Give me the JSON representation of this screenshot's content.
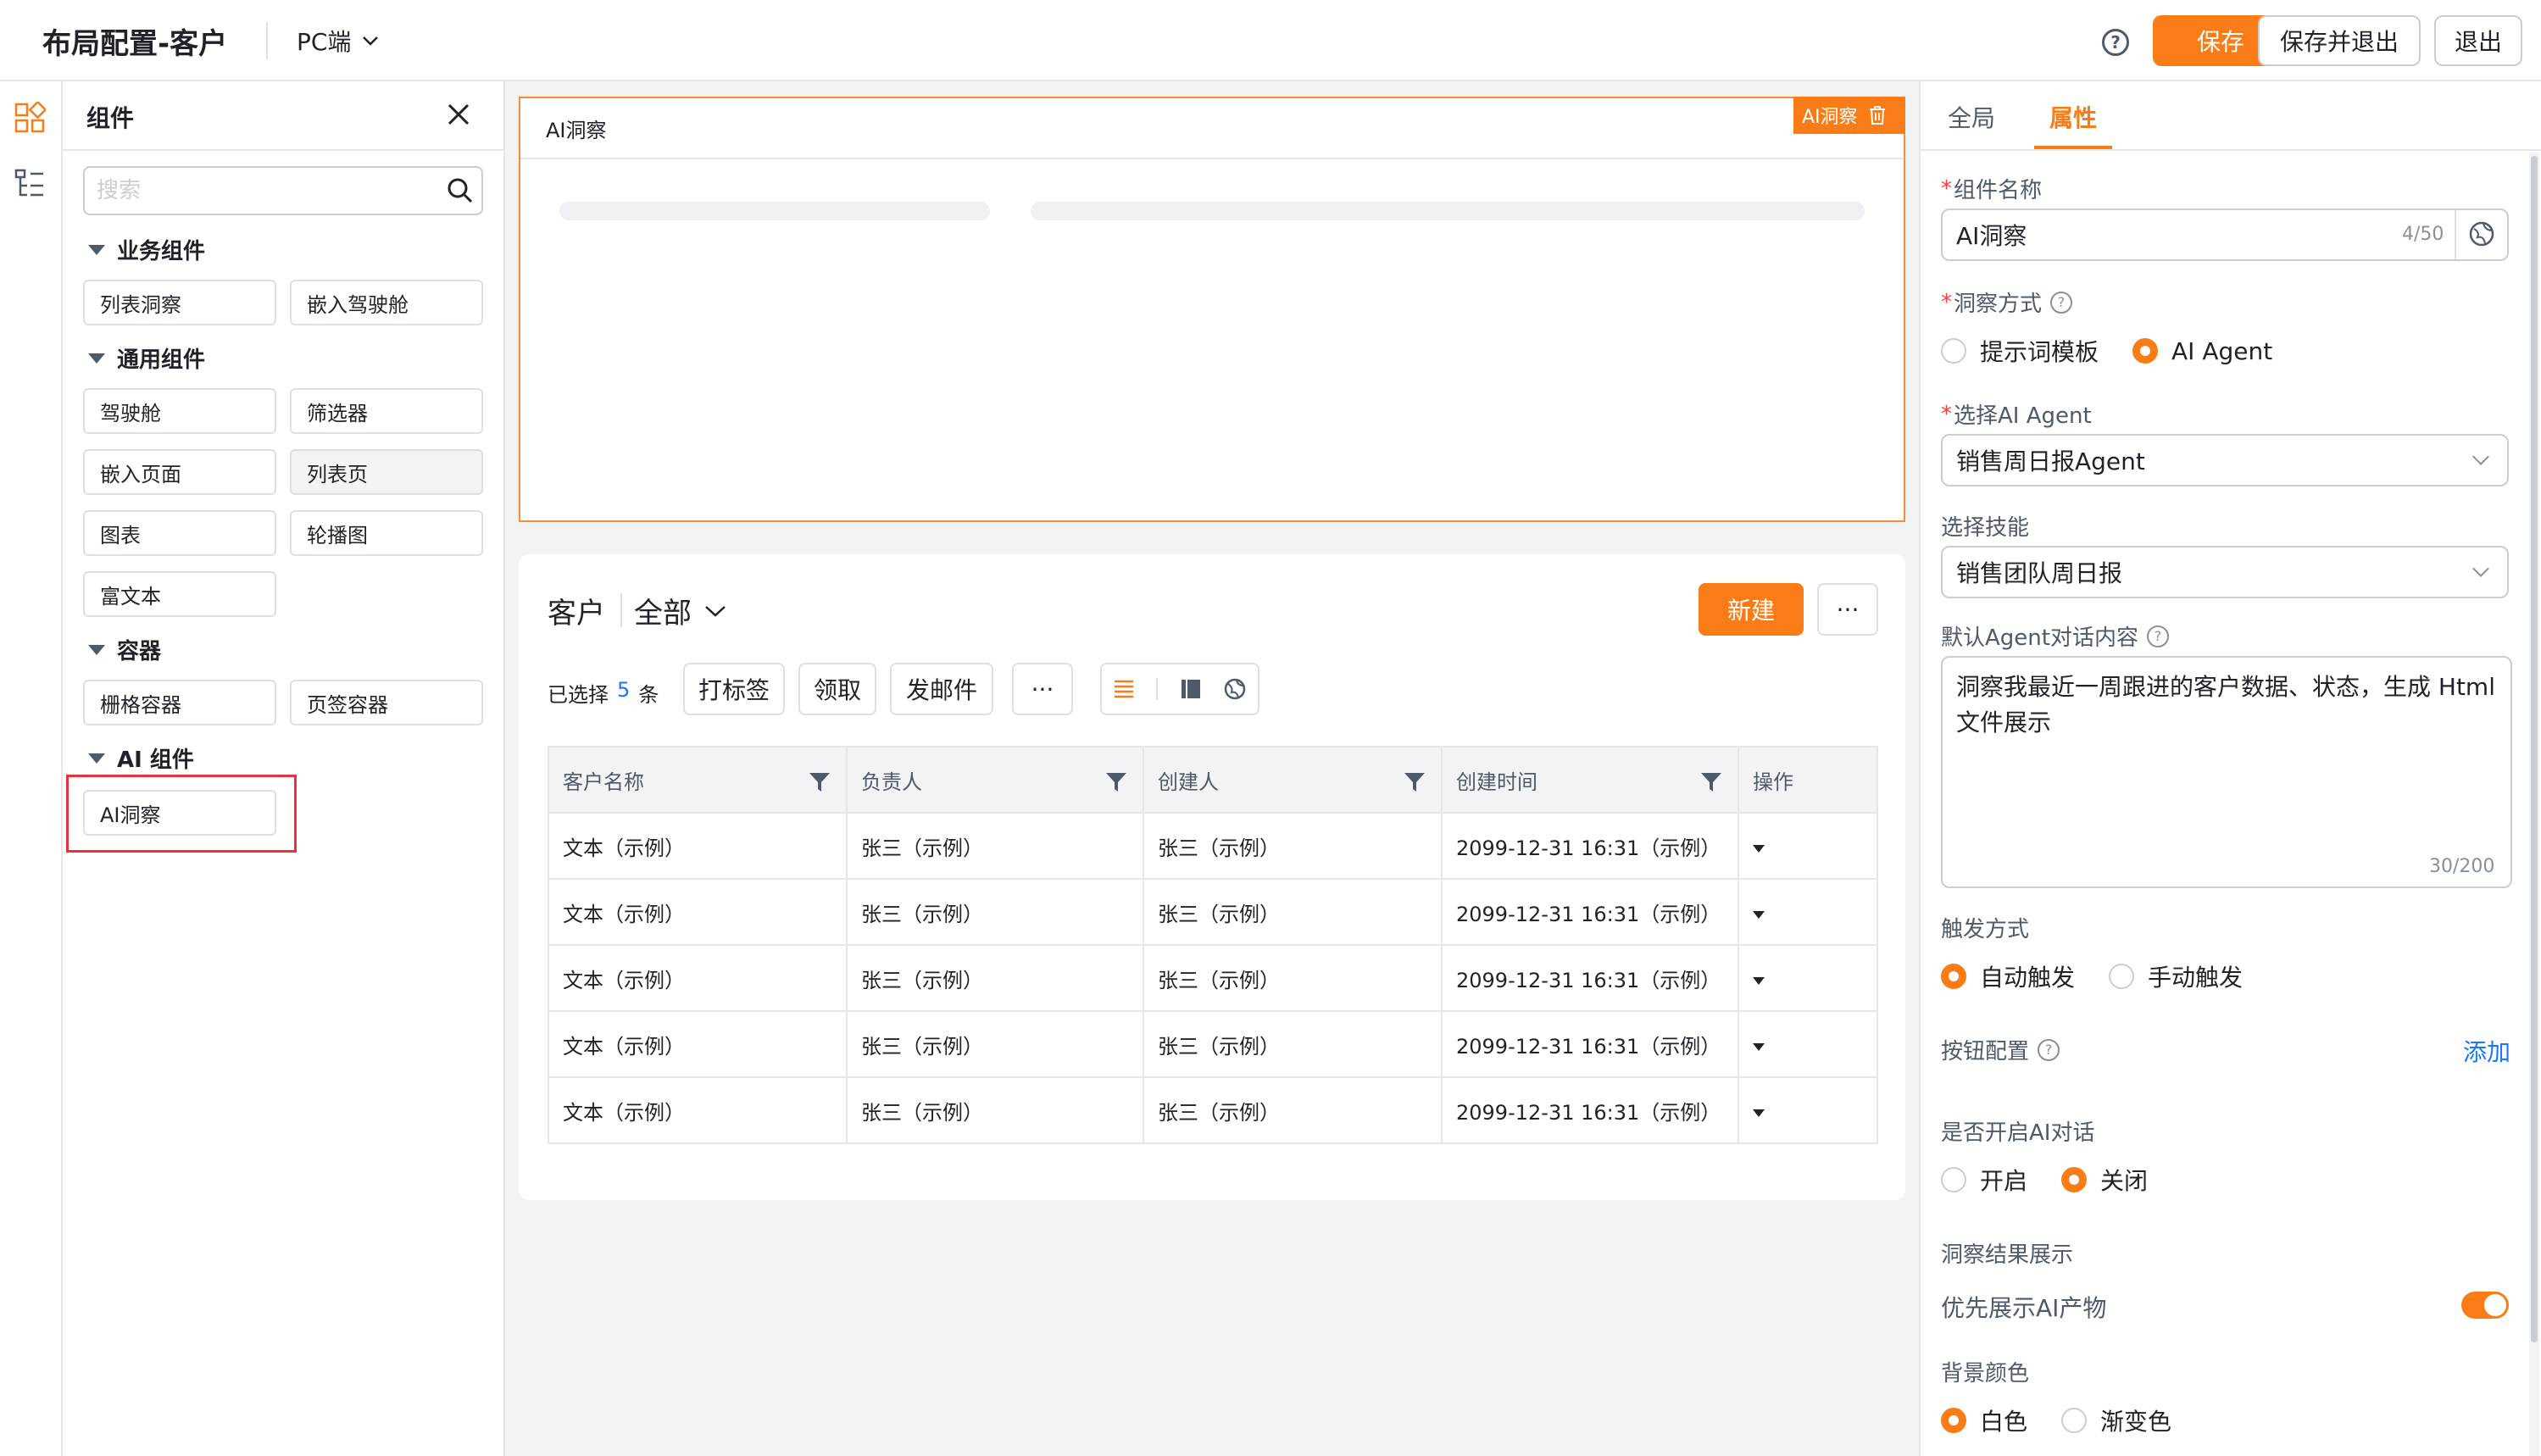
{
  "header": {
    "title": "布局配置-客户",
    "platform": "PC端",
    "save": "保存",
    "save_exit": "保存并退出",
    "exit": "退出"
  },
  "left_panel": {
    "title": "组件",
    "search_placeholder": "搜索",
    "groups": [
      {
        "title": "业务组件",
        "items": [
          "列表洞察",
          "嵌入驾驶舱"
        ]
      },
      {
        "title": "通用组件",
        "items": [
          "驾驶舱",
          "筛选器",
          "嵌入页面",
          "列表页",
          "图表",
          "轮播图",
          "富文本"
        ]
      },
      {
        "title": "容器",
        "items": [
          "栅格容器",
          "页签容器"
        ]
      },
      {
        "title": "AI 组件",
        "items": [
          "AI洞察"
        ]
      }
    ]
  },
  "canvas": {
    "ai_card": {
      "title": "AI洞察",
      "tag": "AI洞察"
    },
    "list_card": {
      "title": "客户",
      "view": "全部",
      "new_button": "新建",
      "more": "···",
      "selected_prefix": "已选择",
      "selected_count": "5",
      "selected_suffix": "条",
      "actions": [
        "打标签",
        "领取",
        "发邮件"
      ],
      "table": {
        "columns": [
          "客户名称",
          "负责人",
          "创建人",
          "创建时间",
          "操作"
        ],
        "rows": [
          [
            "文本（示例）",
            "张三（示例）",
            "张三（示例）",
            "2099-12-31 16:31（示例）"
          ],
          [
            "文本（示例）",
            "张三（示例）",
            "张三（示例）",
            "2099-12-31 16:31（示例）"
          ],
          [
            "文本（示例）",
            "张三（示例）",
            "张三（示例）",
            "2099-12-31 16:31（示例）"
          ],
          [
            "文本（示例）",
            "张三（示例）",
            "张三（示例）",
            "2099-12-31 16:31（示例）"
          ],
          [
            "文本（示例）",
            "张三（示例）",
            "张三（示例）",
            "2099-12-31 16:31（示例）"
          ]
        ]
      }
    }
  },
  "right_panel": {
    "tabs": [
      "全局",
      "属性"
    ],
    "active_tab": "属性",
    "component_name_label": "组件名称",
    "component_name_value": "AI洞察",
    "component_name_count": "4/50",
    "insight_mode_label": "洞察方式",
    "insight_mode_options": [
      "提示词模板",
      "AI Agent"
    ],
    "insight_mode_selected": "AI Agent",
    "agent_label": "选择AI Agent",
    "agent_value": "销售周日报Agent",
    "skill_label": "选择技能",
    "skill_value": "销售团队周日报",
    "default_content_label": "默认Agent对话内容",
    "default_content_value": "洞察我最近一周跟进的客户数据、状态，生成 Html 文件展示",
    "default_content_count": "30/200",
    "trigger_label": "触发方式",
    "trigger_options": [
      "自动触发",
      "手动触发"
    ],
    "trigger_selected": "自动触发",
    "button_config_label": "按钮配置",
    "add_label": "添加",
    "ai_chat_label": "是否开启AI对话",
    "ai_chat_options": [
      "开启",
      "关闭"
    ],
    "ai_chat_selected": "关闭",
    "result_display_label": "洞察结果展示",
    "prefer_ai_label": "优先展示AI产物",
    "prefer_ai_on": true,
    "bg_color_label": "背景颜色",
    "bg_color_options": [
      "白色",
      "渐变色"
    ],
    "bg_color_selected": "白色"
  },
  "colors": {
    "accent": "#fa7c16",
    "link": "#1677ff",
    "highlight": "#e5343f"
  }
}
